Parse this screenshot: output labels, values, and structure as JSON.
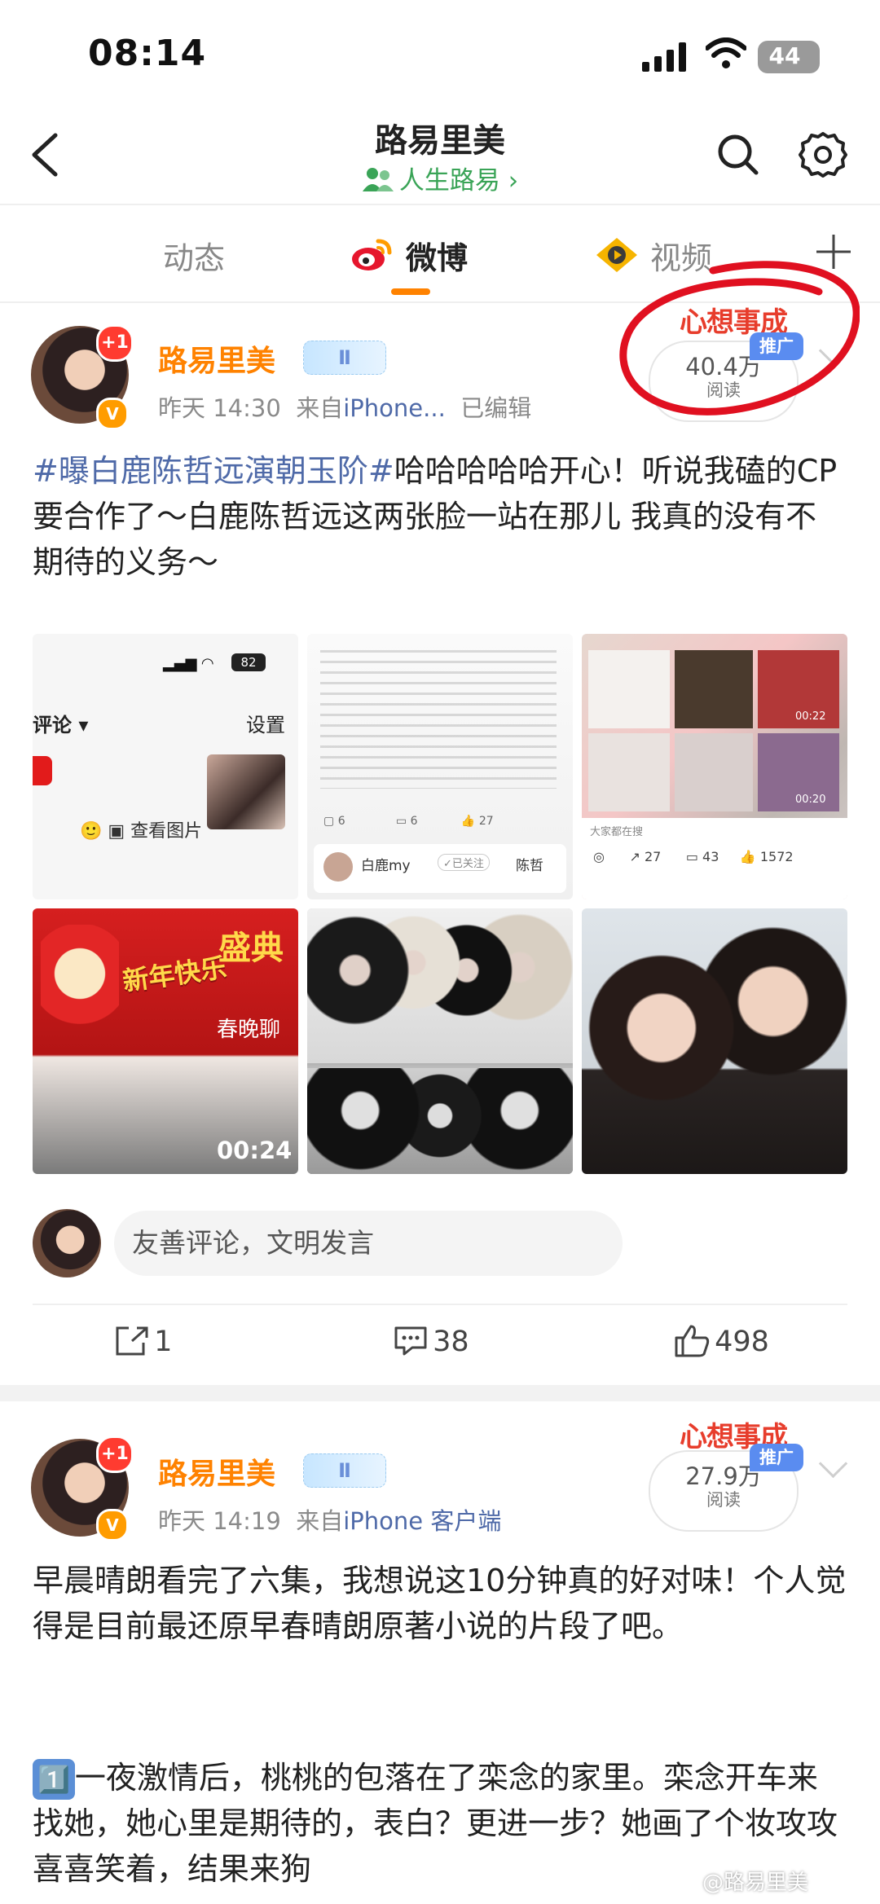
{
  "status_bar": {
    "time": "08:14",
    "battery": "44"
  },
  "header": {
    "title": "路易里美",
    "subtitle": "人生路易",
    "subtitle_chevron": "›"
  },
  "tabs": [
    {
      "label": "动态"
    },
    {
      "label": "微博"
    },
    {
      "label": "视频"
    }
  ],
  "posts": [
    {
      "username": "路易里美",
      "level": "Ⅱ",
      "avatar_badge": "+1",
      "time": "昨天 14:30",
      "source_prefix": "来自",
      "source": "iPhone...",
      "edited": "已编辑",
      "read_count": "40.4万",
      "read_label": "阅读",
      "promo": "推广",
      "promo_banner": "心想事成",
      "hashtag": "#曝白鹿陈哲远演朝玉阶#",
      "text": "哈哈哈哈哈开心！听说我磕的CP要合作了～白鹿陈哲远这两张脸一站在那儿 我真的没有不期待的义务～",
      "media": [
        {
          "kind": "screenshot",
          "header_title": "评论 ▾",
          "header_action": "设置",
          "status_battery": "82",
          "footer_text": "查看图片"
        },
        {
          "kind": "screenshot-text",
          "user1": "白鹿my",
          "user2": "陈哲",
          "follow": "✓已关注",
          "counts": [
            "6",
            "6",
            "27"
          ]
        },
        {
          "kind": "collage",
          "footer": "大家都在搜",
          "counts": [
            "27",
            "43",
            "1572"
          ],
          "durations": [
            "00:22",
            "00:20"
          ]
        },
        {
          "kind": "video",
          "banner1": "新年快乐",
          "banner2": "盛典",
          "banner3": "春晚聊",
          "duration": "00:24"
        },
        {
          "kind": "photo"
        },
        {
          "kind": "photo"
        }
      ],
      "comment_placeholder": "友善评论，文明发言",
      "actions": {
        "share": "1",
        "comment": "38",
        "like": "498"
      }
    },
    {
      "username": "路易里美",
      "level": "Ⅱ",
      "avatar_badge": "+1",
      "time": "昨天 14:19",
      "source_prefix": "来自",
      "source": "iPhone 客户端",
      "read_count": "27.9万",
      "read_label": "阅读",
      "promo": "推广",
      "promo_banner": "心想事成",
      "text": "早晨晴朗看完了六集，我想说这10分钟真的好对味！个人觉得是目前最还原早春晴朗原著小说的片段了吧。",
      "point_emoji": "1️⃣",
      "point_text": "一夜激情后，桃桃的包落在了栾念的家里。栾念开车来找她，她心里是期待的，表白？更进一步？她画了个妆攻攻喜喜笑着，结果来狗"
    }
  ],
  "watermark": "@路易里美",
  "colors": {
    "accent": "#ff8200",
    "link": "#4f6aa8",
    "verified": "#3aa457",
    "annotation": "#e01020"
  }
}
